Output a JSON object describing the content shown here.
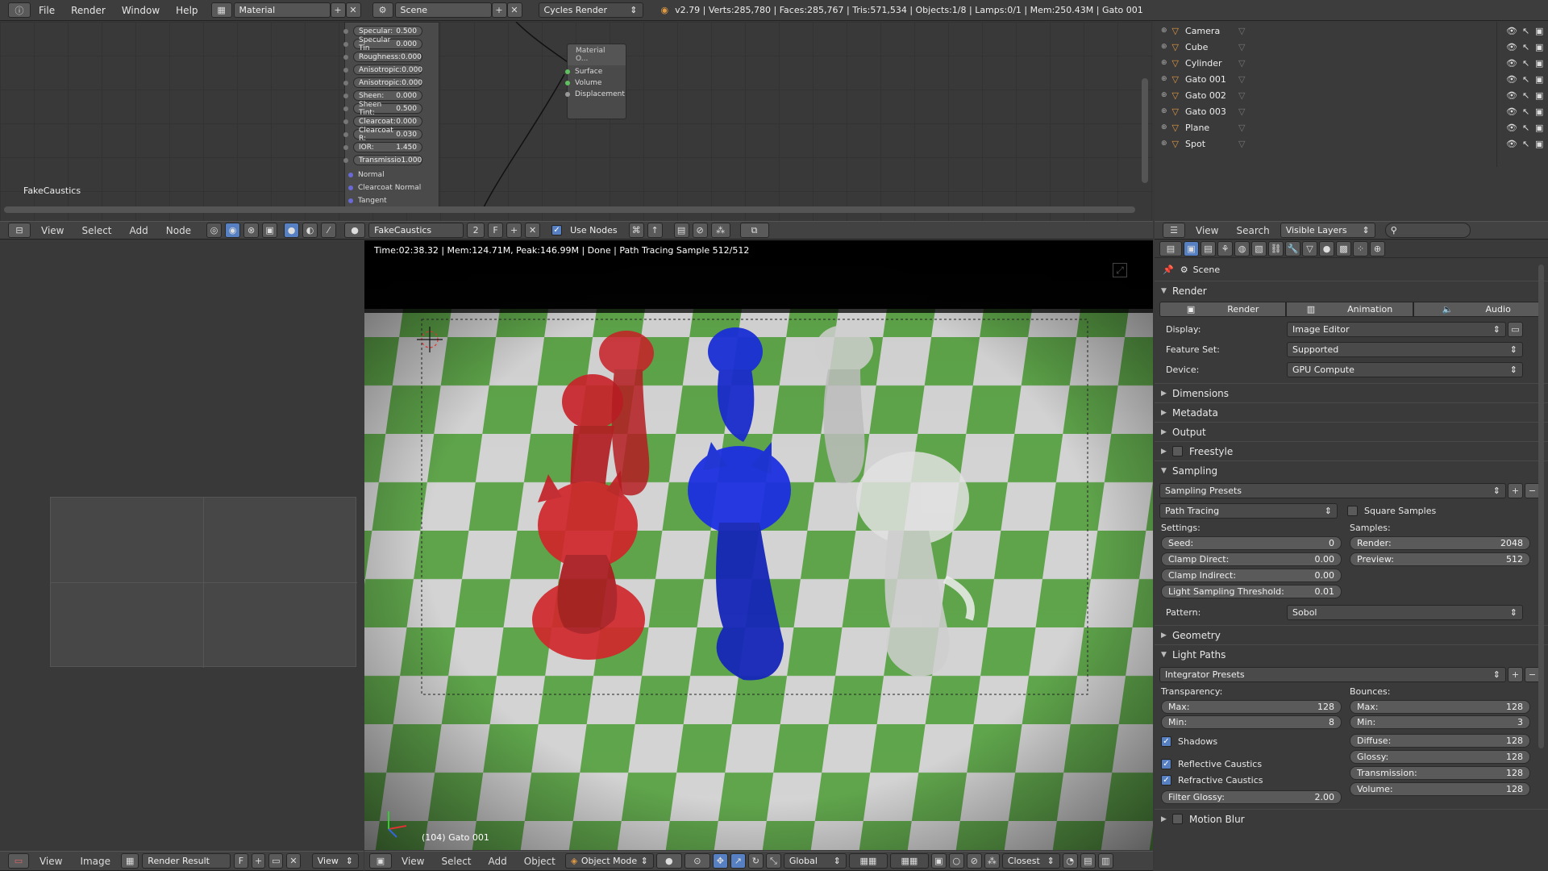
{
  "topbar": {
    "menus": [
      "File",
      "Render",
      "Window",
      "Help"
    ],
    "screen_layout": "Material",
    "scene": "Scene",
    "engine": "Cycles Render",
    "stats": "v2.79 | Verts:285,780 | Faces:285,767 | Tris:571,534 | Objects:1/8 | Lamps:0/1 | Mem:250.43M | Gato 001"
  },
  "node_editor": {
    "material_label": "FakeCaustics",
    "node_fields": [
      {
        "label": "Specular:",
        "value": "0.500"
      },
      {
        "label": "Specular Tin",
        "value": "0.000"
      },
      {
        "label": "Roughness:",
        "value": "0.000"
      },
      {
        "label": "Anisotropic:",
        "value": "0.000"
      },
      {
        "label": "Anisotropic:",
        "value": "0.000"
      },
      {
        "label": "Sheen:",
        "value": "0.000"
      },
      {
        "label": "Sheen Tint:",
        "value": "0.500"
      },
      {
        "label": "Clearcoat:",
        "value": "0.000"
      },
      {
        "label": "Clearcoat R:",
        "value": "0.030"
      },
      {
        "label": "IOR:",
        "value": "1.450"
      },
      {
        "label": "Transmissio",
        "value": "1.000"
      }
    ],
    "node_inputs": [
      "Normal",
      "Clearcoat Normal",
      "Tangent"
    ],
    "output_node": {
      "title": "Material O...",
      "sockets": [
        "Surface",
        "Volume",
        "Displacement"
      ]
    },
    "header": {
      "menus": [
        "View",
        "Select",
        "Add",
        "Node"
      ],
      "material_name": "FakeCaustics",
      "users": "2",
      "fake_user": "F",
      "use_nodes_label": "Use Nodes"
    }
  },
  "outliner": {
    "items": [
      {
        "name": "Camera",
        "icon_color": "#e09a44"
      },
      {
        "name": "Cube",
        "icon_color": "#e09a44"
      },
      {
        "name": "Cylinder",
        "icon_color": "#e09a44"
      },
      {
        "name": "Gato 001",
        "icon_color": "#e09a44"
      },
      {
        "name": "Gato 002",
        "icon_color": "#e09a44"
      },
      {
        "name": "Gato 003",
        "icon_color": "#e09a44"
      },
      {
        "name": "Plane",
        "icon_color": "#e09a44"
      },
      {
        "name": "Spot",
        "icon_color": "#e09a44"
      }
    ],
    "header": {
      "menus": [
        "View",
        "Search"
      ],
      "filter": "Visible Layers"
    }
  },
  "image_editor": {
    "header": {
      "menus": [
        "View",
        "Image"
      ],
      "image": "Render Result",
      "fake_user": "F",
      "view": "View"
    }
  },
  "viewport": {
    "render_status": "Time:02:38.32 | Mem:124.71M, Peak:146.99M | Done | Path Tracing Sample 512/512",
    "object_label": "(104) Gato 001",
    "header": {
      "menus": [
        "View",
        "Select",
        "Add",
        "Object"
      ],
      "mode": "Object Mode",
      "orientation": "Global",
      "snap": "Closest"
    }
  },
  "properties": {
    "breadcrumb": "Scene",
    "render_panel": "Render",
    "render_buttons": [
      "Render",
      "Animation",
      "Audio"
    ],
    "display": {
      "label": "Display:",
      "value": "Image Editor"
    },
    "feature_set": {
      "label": "Feature Set:",
      "value": "Supported"
    },
    "device": {
      "label": "Device:",
      "value": "GPU Compute"
    },
    "collapsed1": [
      "Dimensions",
      "Metadata",
      "Output"
    ],
    "freestyle": "Freestyle",
    "sampling": "Sampling",
    "sampling_presets": "Sampling Presets",
    "integrator": "Path Tracing",
    "square_samples": "Square Samples",
    "settings_label": "Settings:",
    "samples_label": "Samples:",
    "settings": [
      {
        "label": "Seed:",
        "value": "0"
      },
      {
        "label": "Clamp Direct:",
        "value": "0.00"
      },
      {
        "label": "Clamp Indirect:",
        "value": "0.00"
      },
      {
        "label": "Light Sampling Threshold:",
        "value": "0.01"
      }
    ],
    "samples": [
      {
        "label": "Render:",
        "value": "2048"
      },
      {
        "label": "Preview:",
        "value": "512"
      }
    ],
    "pattern": {
      "label": "Pattern:",
      "value": "Sobol"
    },
    "geometry": "Geometry",
    "light_paths": "Light Paths",
    "integrator_presets": "Integrator Presets",
    "transparency_label": "Transparency:",
    "bounces_label": "Bounces:",
    "transparency": [
      {
        "label": "Max:",
        "value": "128"
      },
      {
        "label": "Min:",
        "value": "8"
      }
    ],
    "bounces_top": [
      {
        "label": "Max:",
        "value": "128"
      },
      {
        "label": "Min:",
        "value": "3"
      }
    ],
    "bounces_bottom": [
      {
        "label": "Diffuse:",
        "value": "128"
      },
      {
        "label": "Glossy:",
        "value": "128"
      },
      {
        "label": "Transmission:",
        "value": "128"
      },
      {
        "label": "Volume:",
        "value": "128"
      }
    ],
    "shadows": "Shadows",
    "reflective_caustics": "Reflective Caustics",
    "refractive_caustics": "Refractive Caustics",
    "filter_glossy": {
      "label": "Filter Glossy:",
      "value": "2.00"
    },
    "motion_blur": "Motion Blur"
  }
}
